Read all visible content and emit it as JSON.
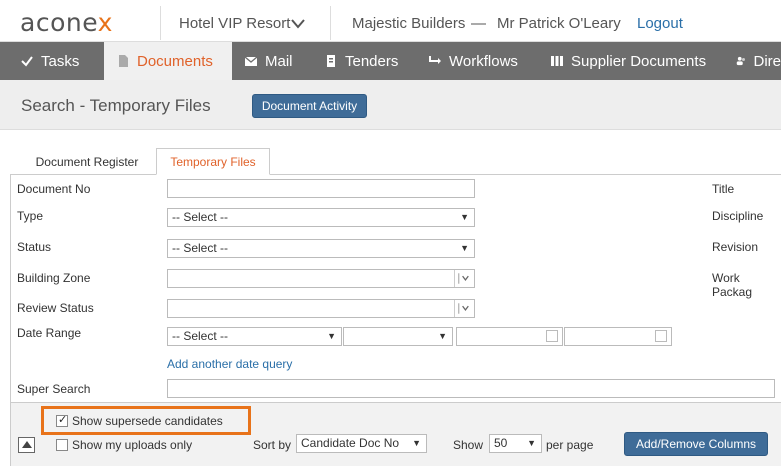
{
  "header": {
    "logo_prefix": "acone",
    "logo_accent": "x",
    "project": "Hotel VIP Resort",
    "organization": "Majestic Builders",
    "separator": "—",
    "user": "Mr Patrick O'Leary",
    "logout": "Logout"
  },
  "nav": {
    "items": [
      {
        "label": "Tasks",
        "icon": "check-icon"
      },
      {
        "label": "Documents",
        "icon": "document-icon"
      },
      {
        "label": "Mail",
        "icon": "mail-icon"
      },
      {
        "label": "Tenders",
        "icon": "tender-icon"
      },
      {
        "label": "Workflows",
        "icon": "workflow-icon"
      },
      {
        "label": "Supplier Documents",
        "icon": "supplier-docs-icon"
      },
      {
        "label": "Dire",
        "icon": "people-icon"
      }
    ],
    "active": "Documents"
  },
  "page": {
    "title": "Search - Temporary Files",
    "activity_button": "Document Activity"
  },
  "tabs": [
    {
      "label": "Document Register"
    },
    {
      "label": "Temporary Files"
    }
  ],
  "form": {
    "document_no_label": "Document No",
    "document_no_value": "",
    "type_label": "Type",
    "type_value": "-- Select --",
    "status_label": "Status",
    "status_value": "-- Select --",
    "building_zone_label": "Building Zone",
    "review_status_label": "Review Status",
    "date_range_label": "Date Range",
    "date_range_value": "-- Select --",
    "add_date_query": "Add another date query",
    "super_search_label": "Super Search",
    "right_labels": {
      "title": "Title",
      "discipline": "Discipline",
      "revision": "Revision",
      "work_package": "Work Packag"
    }
  },
  "options": {
    "show_supersede": "Show supersede candidates",
    "show_supersede_checked": true,
    "show_uploads": "Show my uploads only",
    "show_uploads_checked": false,
    "sort_by_label": "Sort by",
    "sort_by_value": "Candidate Doc No",
    "show_label": "Show",
    "show_value": "50",
    "per_page": "per page",
    "add_remove_columns": "Add/Remove Columns"
  },
  "colors": {
    "accent_orange": "#e0622a",
    "nav_bg": "#6d6d6d",
    "button_blue": "#3f6c98",
    "link_blue": "#2a6fa8"
  }
}
